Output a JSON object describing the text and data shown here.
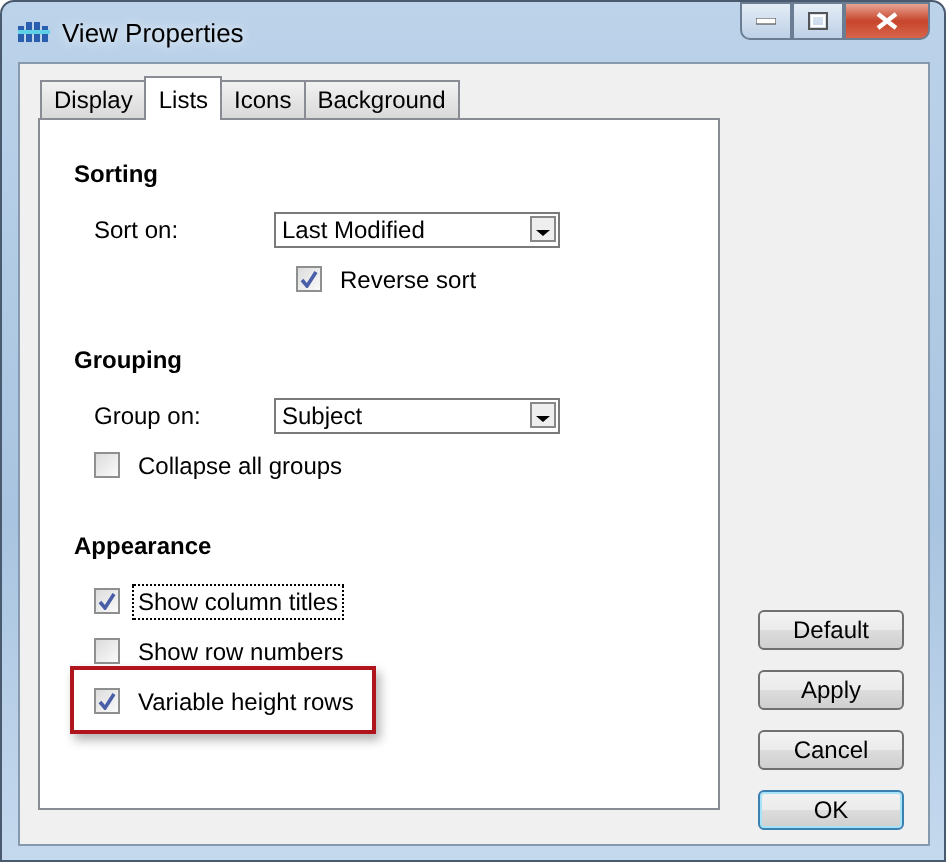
{
  "window": {
    "title": "View Properties"
  },
  "tabs": [
    {
      "label": "Display",
      "selected": false
    },
    {
      "label": "Lists",
      "selected": true
    },
    {
      "label": "Icons",
      "selected": false
    },
    {
      "label": "Background",
      "selected": false
    }
  ],
  "sections": [
    {
      "heading": "Sorting",
      "rows": [
        {
          "kind": "select",
          "label": "Sort on:",
          "value": "Last Modified"
        },
        {
          "kind": "suboption",
          "label": "Reverse sort",
          "checked": true,
          "focused": false,
          "highlighted": false
        }
      ]
    },
    {
      "heading": "Grouping",
      "rows": [
        {
          "kind": "select",
          "label": "Group on:",
          "value": "Subject"
        },
        {
          "kind": "checkbox",
          "label": "Collapse all groups",
          "checked": false,
          "focused": false,
          "highlighted": false
        }
      ]
    },
    {
      "heading": "Appearance",
      "rows": [
        {
          "kind": "checkbox",
          "label": "Show column titles",
          "checked": true,
          "focused": true,
          "highlighted": false
        },
        {
          "kind": "checkbox",
          "label": "Show row numbers",
          "checked": false,
          "focused": false,
          "highlighted": false
        },
        {
          "kind": "checkbox",
          "label": "Variable height rows",
          "checked": true,
          "focused": false,
          "highlighted": true
        }
      ]
    }
  ],
  "buttons": [
    {
      "label": "Default",
      "default": false
    },
    {
      "label": "Apply",
      "default": false
    },
    {
      "label": "Cancel",
      "default": false
    },
    {
      "label": "OK",
      "default": true
    }
  ]
}
